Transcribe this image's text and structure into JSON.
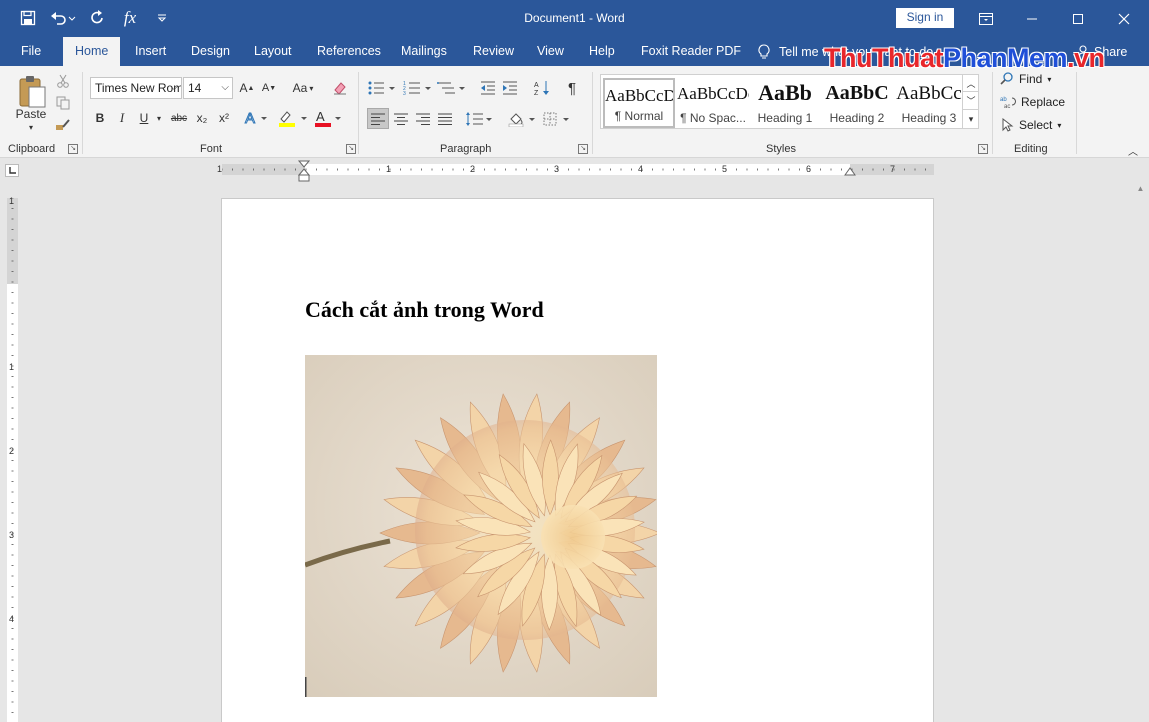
{
  "window": {
    "title": "Document1  -  Word",
    "sign_in": "Sign in",
    "qat_fx": "fx"
  },
  "tabs": [
    {
      "label": "File"
    },
    {
      "label": "Home"
    },
    {
      "label": "Insert"
    },
    {
      "label": "Design"
    },
    {
      "label": "Layout"
    },
    {
      "label": "References"
    },
    {
      "label": "Mailings"
    },
    {
      "label": "Review"
    },
    {
      "label": "View"
    },
    {
      "label": "Help"
    },
    {
      "label": "Foxit Reader PDF"
    }
  ],
  "active_tab": "Home",
  "tell_me": "Tell me what you want to do",
  "share": "Share",
  "watermark": {
    "part1": "ThuThuat",
    "part2": "PhanMem",
    "part3": ".vn"
  },
  "ribbon": {
    "clipboard": {
      "label": "Clipboard",
      "paste": "Paste"
    },
    "font": {
      "label": "Font",
      "font_name": "Times New Roman",
      "font_size": "14",
      "change_case": "Aa",
      "bold": "B",
      "italic": "I",
      "underline": "U",
      "strikethrough": "abc",
      "subscript": "x₂",
      "superscript": "x²"
    },
    "paragraph": {
      "label": "Paragraph",
      "show_marks": "¶"
    },
    "styles": {
      "label": "Styles",
      "items": [
        {
          "sample": "AaBbCcDc",
          "name": "¶ Normal"
        },
        {
          "sample": "AaBbCcDc",
          "name": "¶ No Spac..."
        },
        {
          "sample": "AaBb",
          "name": "Heading 1"
        },
        {
          "sample": "AaBbC",
          "name": "Heading 2"
        },
        {
          "sample": "AaBbCc",
          "name": "Heading 3"
        }
      ]
    },
    "editing": {
      "label": "Editing",
      "find": "Find",
      "replace": "Replace",
      "select": "Select"
    }
  },
  "ruler": {
    "h_numbers": [
      "1",
      "1",
      "2",
      "3",
      "4",
      "5",
      "6",
      "7"
    ],
    "v_numbers": [
      "1",
      "1",
      "2",
      "3",
      "4"
    ]
  },
  "document": {
    "heading": "Cách cắt ảnh trong Word"
  },
  "colors": {
    "accent": "#2b579a",
    "watermark_red": "#e8262b",
    "watermark_blue": "#1f4fd8"
  }
}
